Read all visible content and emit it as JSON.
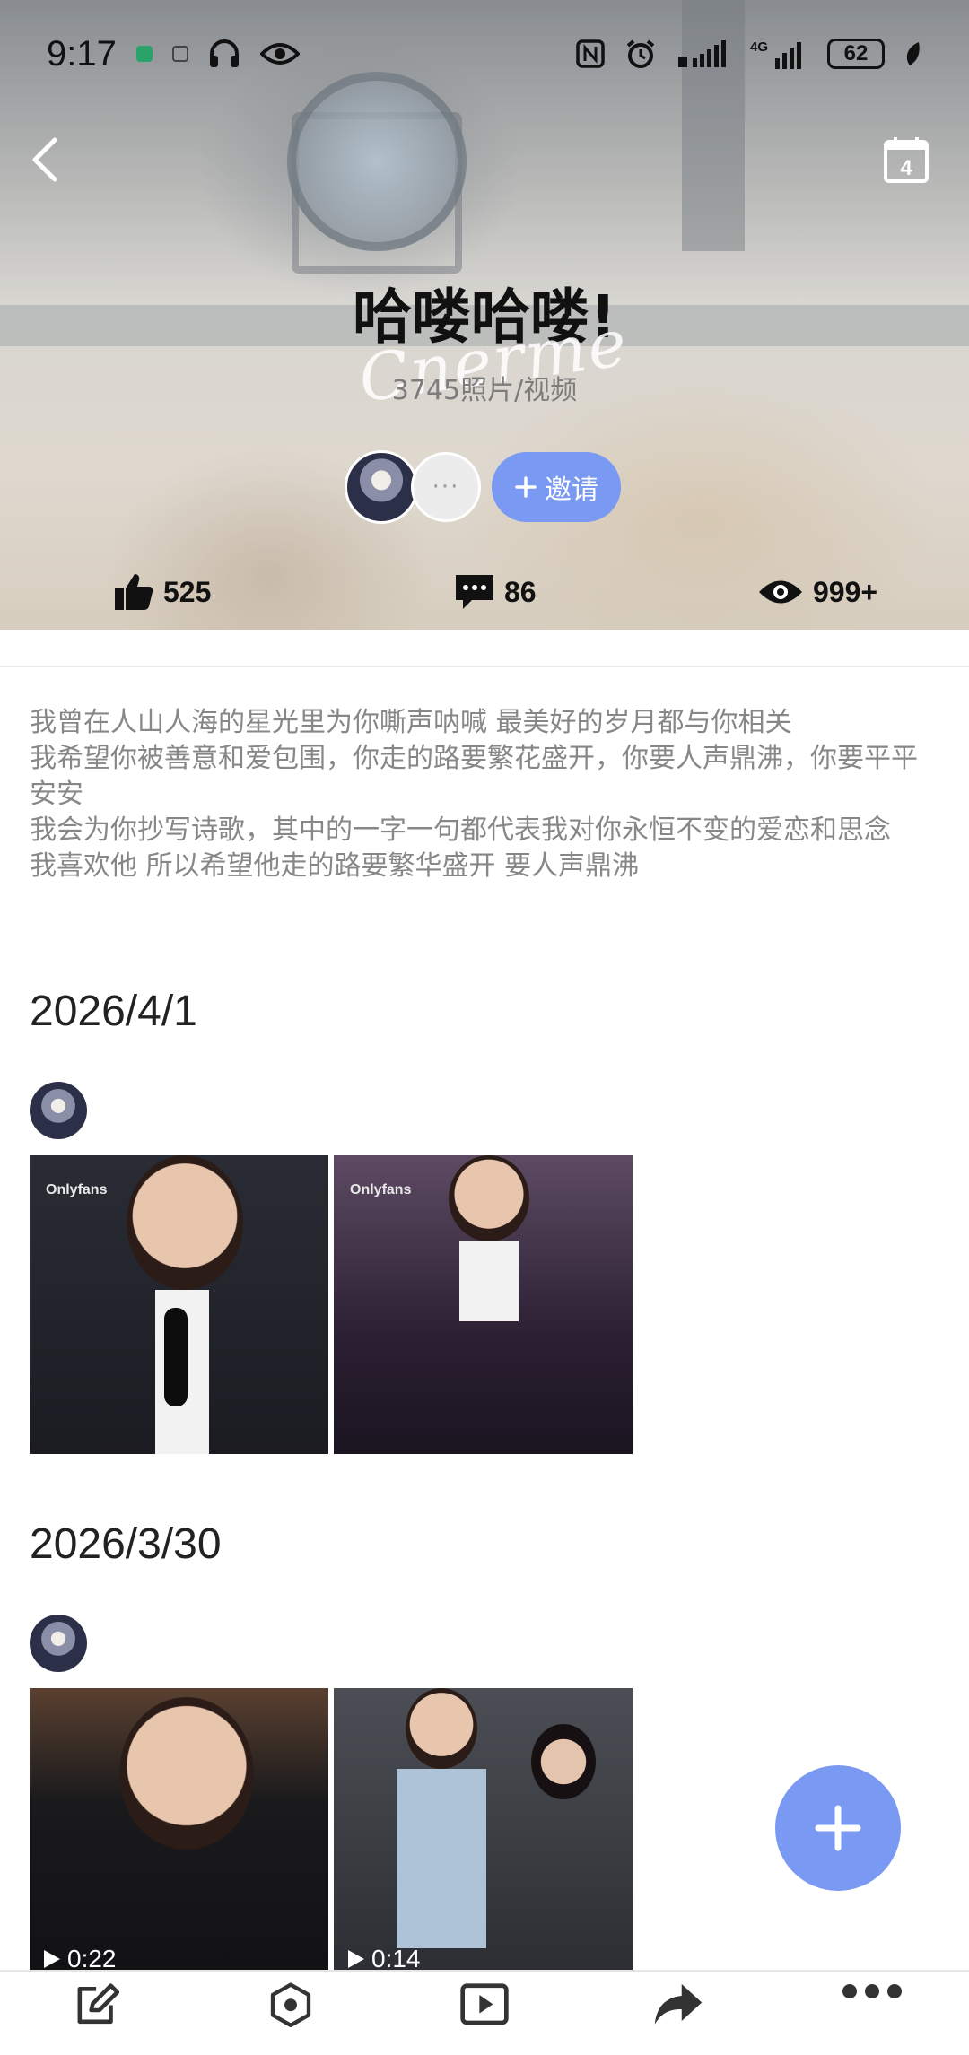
{
  "status_bar": {
    "time": "9:17",
    "battery": "62",
    "network": "4G"
  },
  "album": {
    "title": "哈喽哈喽!",
    "watermark": "Cnerme",
    "count": "3745照片/视频",
    "invite_label": "邀请",
    "more_members": "···",
    "likes": "525",
    "comments": "86",
    "views": "999+"
  },
  "description": "我曾在人山人海的星光里为你嘶声呐喊 最美好的岁月都与你相关\n我希望你被善意和爱包围，你走的路要繁花盛开，你要人声鼎沸，你要平平安安\n我会为你抄写诗歌，其中的一字一句都代表我对你永恒不变的爱恋和思念\n我喜欢他 所以希望他走的路要繁华盛开 要人声鼎沸",
  "feed": [
    {
      "date": "2026/4/1",
      "photos": [
        {
          "brand": "Onlyfans",
          "duration": ""
        },
        {
          "brand": "Onlyfans",
          "duration": ""
        }
      ]
    },
    {
      "date": "2026/3/30",
      "photos": [
        {
          "brand": "",
          "duration": "0:22"
        },
        {
          "brand": "",
          "duration": "0:14"
        }
      ]
    }
  ],
  "toolbar": {
    "items": [
      {
        "icon": "edit-icon",
        "label": ""
      },
      {
        "icon": "hexagon-icon",
        "label": ""
      },
      {
        "icon": "play-icon",
        "label": ""
      },
      {
        "icon": "share-icon",
        "label": ""
      },
      {
        "icon": "more-icon",
        "label": ""
      }
    ]
  },
  "colors": {
    "accent": "#7a99f2",
    "description_text": "#878787"
  }
}
